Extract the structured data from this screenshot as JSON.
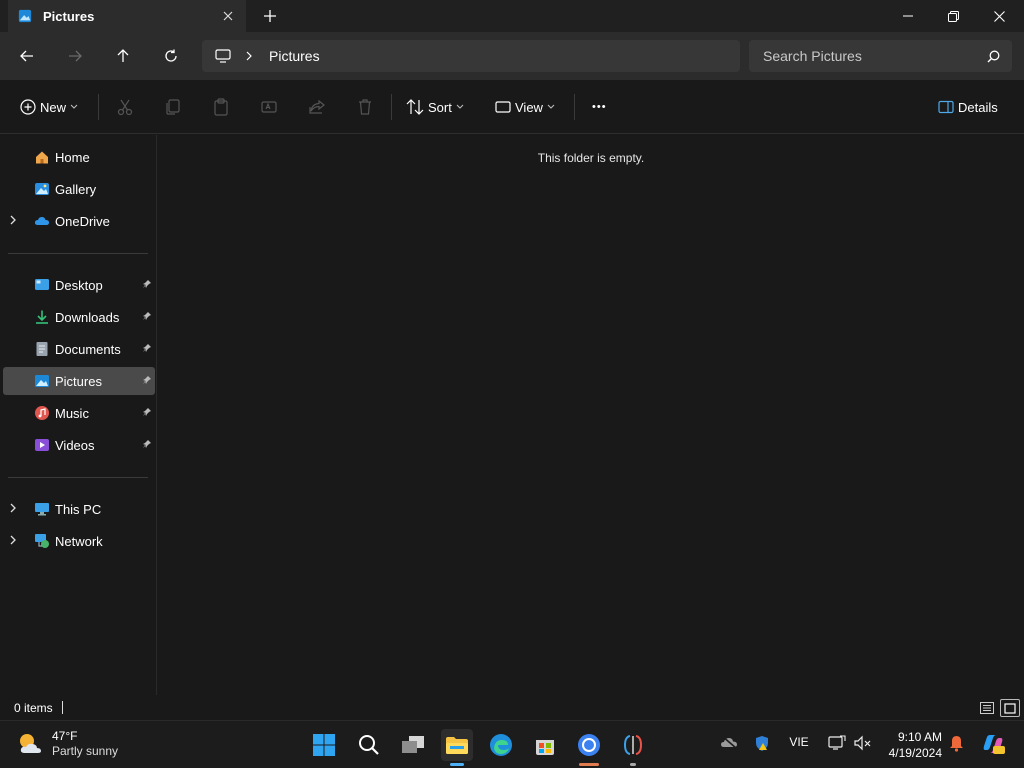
{
  "window": {
    "tab_title": "Pictures",
    "new_tab_symbol": "+",
    "controls": [
      "minimize-icon",
      "restore-icon",
      "close-icon"
    ]
  },
  "navigation": {
    "buttons": [
      "back-icon",
      "forward-icon",
      "up-icon",
      "refresh-icon"
    ],
    "breadcrumb": [
      "Pictures"
    ],
    "search_placeholder": "Search Pictures"
  },
  "commandbar": {
    "new_label": "New",
    "sort_label": "Sort",
    "view_label": "View",
    "details_label": "Details",
    "more_symbol": "•••"
  },
  "sidebar": {
    "top": [
      {
        "label": "Home",
        "icon": "home-icon"
      },
      {
        "label": "Gallery",
        "icon": "gallery-icon"
      },
      {
        "label": "OneDrive",
        "icon": "onedrive-icon",
        "expandable": true
      }
    ],
    "quick_access": [
      {
        "label": "Desktop",
        "icon": "desktop-icon",
        "pinned": true
      },
      {
        "label": "Downloads",
        "icon": "downloads-icon",
        "pinned": true
      },
      {
        "label": "Documents",
        "icon": "documents-icon",
        "pinned": true
      },
      {
        "label": "Pictures",
        "icon": "pictures-icon",
        "pinned": true,
        "selected": true
      },
      {
        "label": "Music",
        "icon": "music-icon",
        "pinned": true
      },
      {
        "label": "Videos",
        "icon": "videos-icon",
        "pinned": true
      }
    ],
    "devices": [
      {
        "label": "This PC",
        "icon": "this-pc-icon",
        "expandable": true
      },
      {
        "label": "Network",
        "icon": "network-icon",
        "expandable": true
      }
    ]
  },
  "content": {
    "empty_message": "This folder is empty."
  },
  "status": {
    "item_count": "0 items"
  },
  "taskbar": {
    "weather_temp": "47°F",
    "weather_desc": "Partly sunny",
    "apps": [
      "start-icon",
      "search-icon",
      "task-view-icon",
      "file-explorer-icon",
      "edge-icon",
      "store-icon",
      "chrome-icon",
      "app-icon"
    ],
    "language": "VIE",
    "time": "9:10 AM",
    "date": "4/19/2024"
  },
  "colors": {
    "accent": "#0078d4",
    "background": "#191919",
    "toolbar": "#2c2c2c",
    "selected": "#4a4a4a"
  }
}
